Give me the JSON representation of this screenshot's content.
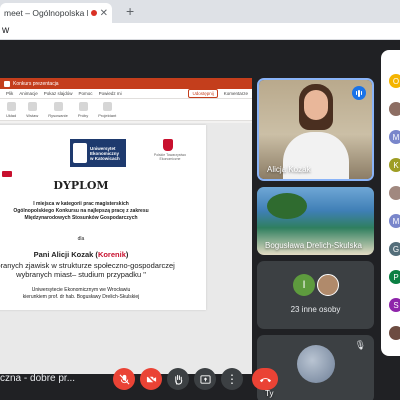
{
  "browser": {
    "tab_title": "meet – Ogólnopolska konf",
    "tab_close": "✕",
    "new_tab": "+",
    "address_fragment": "w"
  },
  "presentation": {
    "window_title": "Konkurs prezentacja",
    "menu": [
      "Plik",
      "Animacje",
      "Pokaz slajdów",
      "Pomoc",
      "Powiedz mi"
    ],
    "share_label": "Udostępnij",
    "comments_label": "Komentarze",
    "ribbon": [
      "Układ",
      "Wstaw",
      "Rysowanie",
      "Próby",
      "Projektant"
    ],
    "slide": {
      "uni_logo_text": "Uniwersytet\nEkonomiczny\nw Katowicach",
      "org_logo_text": "Polskie Towarzystwo\nEkonomiczne",
      "title": "DYPLOM",
      "award": "I miejsca w kategorii prac magisterskich\nOgólnopolskiego Konkursu na najlepszą pracę z zakresu\nMiędzynarodowych Stosunków Gospodarczych",
      "dla": "dla",
      "name_main": "Pani Alicji Kozak (",
      "name_red": "Korenik",
      "name_close": ")",
      "thesis": "wybranych zjawisk w strukturze społeczno-gospodarczej\nwybranych miast– studium przypadku \"",
      "footer": "Uniwersytecie Ekonomicznym we Wrocławiu\nkierunkiem prof. dr hab. Bogusławy Drelich-Skulskiej"
    }
  },
  "participants": [
    {
      "name": "Alicja Kozak",
      "speaking": true
    },
    {
      "name": "Bogusława Drelich-Skulska"
    },
    {
      "initial": "I",
      "label": "23 inne osoby"
    },
    {
      "name": "Ty",
      "muted": true
    }
  ],
  "side_panel": {
    "avatars": [
      {
        "letter": "O",
        "color": "#f4b400"
      },
      {
        "letter": "",
        "color": "#8d6e63"
      },
      {
        "letter": "M",
        "color": "#7986cb"
      },
      {
        "letter": "K",
        "color": "#9e9d24"
      },
      {
        "letter": "",
        "color": "#a1887f"
      },
      {
        "letter": "M",
        "color": "#7986cb"
      },
      {
        "letter": "G",
        "color": "#546e7a"
      },
      {
        "letter": "P",
        "color": "#0b8043"
      },
      {
        "letter": "S",
        "color": "#8e24aa"
      },
      {
        "letter": "",
        "color": "#6d4c41"
      }
    ]
  },
  "meeting": {
    "name": "czna - dobre pr..."
  },
  "controls": {
    "mic_icon": "mic-off-icon",
    "camera_icon": "camera-off-icon",
    "hand_icon": "raise-hand-icon",
    "present_icon": "present-icon",
    "more_icon": "more-options-icon",
    "end_icon": "end-call-icon"
  },
  "colors": {
    "ppt_accent": "#c43e1c",
    "speaking": "#1a73e8",
    "end_call": "#ea4335",
    "meet_bg": "#202124"
  }
}
